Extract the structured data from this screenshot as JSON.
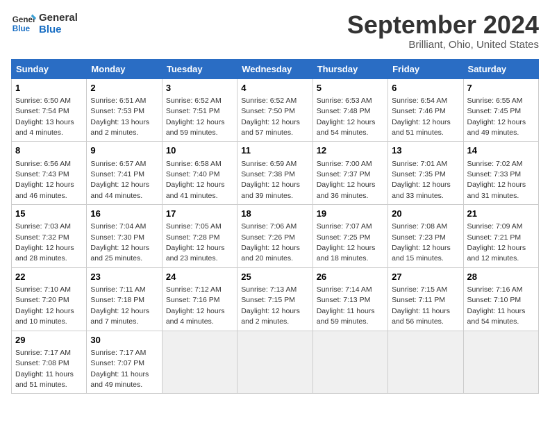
{
  "logo": {
    "line1": "General",
    "line2": "Blue"
  },
  "title": "September 2024",
  "subtitle": "Brilliant, Ohio, United States",
  "headers": [
    "Sunday",
    "Monday",
    "Tuesday",
    "Wednesday",
    "Thursday",
    "Friday",
    "Saturday"
  ],
  "rows": [
    [
      {
        "day": "1",
        "sunrise": "6:50 AM",
        "sunset": "7:54 PM",
        "daylight": "13 hours and 4 minutes."
      },
      {
        "day": "2",
        "sunrise": "6:51 AM",
        "sunset": "7:53 PM",
        "daylight": "13 hours and 2 minutes."
      },
      {
        "day": "3",
        "sunrise": "6:52 AM",
        "sunset": "7:51 PM",
        "daylight": "12 hours and 59 minutes."
      },
      {
        "day": "4",
        "sunrise": "6:52 AM",
        "sunset": "7:50 PM",
        "daylight": "12 hours and 57 minutes."
      },
      {
        "day": "5",
        "sunrise": "6:53 AM",
        "sunset": "7:48 PM",
        "daylight": "12 hours and 54 minutes."
      },
      {
        "day": "6",
        "sunrise": "6:54 AM",
        "sunset": "7:46 PM",
        "daylight": "12 hours and 51 minutes."
      },
      {
        "day": "7",
        "sunrise": "6:55 AM",
        "sunset": "7:45 PM",
        "daylight": "12 hours and 49 minutes."
      }
    ],
    [
      {
        "day": "8",
        "sunrise": "6:56 AM",
        "sunset": "7:43 PM",
        "daylight": "12 hours and 46 minutes."
      },
      {
        "day": "9",
        "sunrise": "6:57 AM",
        "sunset": "7:41 PM",
        "daylight": "12 hours and 44 minutes."
      },
      {
        "day": "10",
        "sunrise": "6:58 AM",
        "sunset": "7:40 PM",
        "daylight": "12 hours and 41 minutes."
      },
      {
        "day": "11",
        "sunrise": "6:59 AM",
        "sunset": "7:38 PM",
        "daylight": "12 hours and 39 minutes."
      },
      {
        "day": "12",
        "sunrise": "7:00 AM",
        "sunset": "7:37 PM",
        "daylight": "12 hours and 36 minutes."
      },
      {
        "day": "13",
        "sunrise": "7:01 AM",
        "sunset": "7:35 PM",
        "daylight": "12 hours and 33 minutes."
      },
      {
        "day": "14",
        "sunrise": "7:02 AM",
        "sunset": "7:33 PM",
        "daylight": "12 hours and 31 minutes."
      }
    ],
    [
      {
        "day": "15",
        "sunrise": "7:03 AM",
        "sunset": "7:32 PM",
        "daylight": "12 hours and 28 minutes."
      },
      {
        "day": "16",
        "sunrise": "7:04 AM",
        "sunset": "7:30 PM",
        "daylight": "12 hours and 25 minutes."
      },
      {
        "day": "17",
        "sunrise": "7:05 AM",
        "sunset": "7:28 PM",
        "daylight": "12 hours and 23 minutes."
      },
      {
        "day": "18",
        "sunrise": "7:06 AM",
        "sunset": "7:26 PM",
        "daylight": "12 hours and 20 minutes."
      },
      {
        "day": "19",
        "sunrise": "7:07 AM",
        "sunset": "7:25 PM",
        "daylight": "12 hours and 18 minutes."
      },
      {
        "day": "20",
        "sunrise": "7:08 AM",
        "sunset": "7:23 PM",
        "daylight": "12 hours and 15 minutes."
      },
      {
        "day": "21",
        "sunrise": "7:09 AM",
        "sunset": "7:21 PM",
        "daylight": "12 hours and 12 minutes."
      }
    ],
    [
      {
        "day": "22",
        "sunrise": "7:10 AM",
        "sunset": "7:20 PM",
        "daylight": "12 hours and 10 minutes."
      },
      {
        "day": "23",
        "sunrise": "7:11 AM",
        "sunset": "7:18 PM",
        "daylight": "12 hours and 7 minutes."
      },
      {
        "day": "24",
        "sunrise": "7:12 AM",
        "sunset": "7:16 PM",
        "daylight": "12 hours and 4 minutes."
      },
      {
        "day": "25",
        "sunrise": "7:13 AM",
        "sunset": "7:15 PM",
        "daylight": "12 hours and 2 minutes."
      },
      {
        "day": "26",
        "sunrise": "7:14 AM",
        "sunset": "7:13 PM",
        "daylight": "11 hours and 59 minutes."
      },
      {
        "day": "27",
        "sunrise": "7:15 AM",
        "sunset": "7:11 PM",
        "daylight": "11 hours and 56 minutes."
      },
      {
        "day": "28",
        "sunrise": "7:16 AM",
        "sunset": "7:10 PM",
        "daylight": "11 hours and 54 minutes."
      }
    ],
    [
      {
        "day": "29",
        "sunrise": "7:17 AM",
        "sunset": "7:08 PM",
        "daylight": "11 hours and 51 minutes."
      },
      {
        "day": "30",
        "sunrise": "7:17 AM",
        "sunset": "7:07 PM",
        "daylight": "11 hours and 49 minutes."
      },
      null,
      null,
      null,
      null,
      null
    ]
  ]
}
